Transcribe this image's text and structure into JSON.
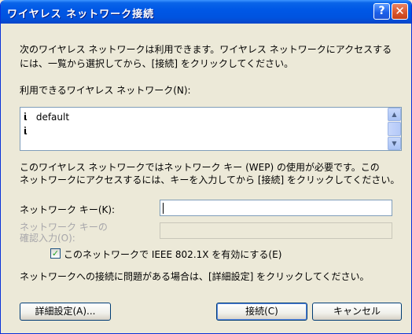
{
  "window": {
    "title": "ワイヤレス ネットワーク接続",
    "help_glyph": "?",
    "close_glyph": "✕"
  },
  "intro": {
    "line1": "次のワイヤレス ネットワークは利用できます。ワイヤレス ネットワークにアクセスする",
    "line2": "には、一覧から選択してから、[接続] をクリックしてください。"
  },
  "available_label": "利用できるワイヤレス ネットワーク(N):",
  "networks": [
    {
      "name": "default",
      "icon": "wireless-network-icon"
    },
    {
      "name": "",
      "icon": "wireless-network-icon"
    }
  ],
  "wep_note": {
    "line1": "このワイヤレス ネットワークではネットワーク キー (WEP) の使用が必要です。この",
    "line2": "ネットワークにアクセスするには、キーを入力してから [接続] をクリックしてください。"
  },
  "key_label": "ネットワーク キー(K):",
  "key_value": "",
  "confirm_label": {
    "line1": "ネットワーク キーの",
    "line2": "確認入力(O):"
  },
  "ieee_checkbox": {
    "label": "このネットワークで IEEE 802.1X を有効にする(E)",
    "checked": true
  },
  "problem_note": "ネットワークへの接続に問題がある場合は、[詳細設定] をクリックしてください。",
  "buttons": {
    "advanced": "詳細設定(A)...",
    "connect": "接続(C)",
    "cancel": "キャンセル"
  },
  "colors": {
    "title_bar": "#0058e6",
    "dialog_bg": "#ece9d8",
    "close_button": "#d8542a"
  }
}
